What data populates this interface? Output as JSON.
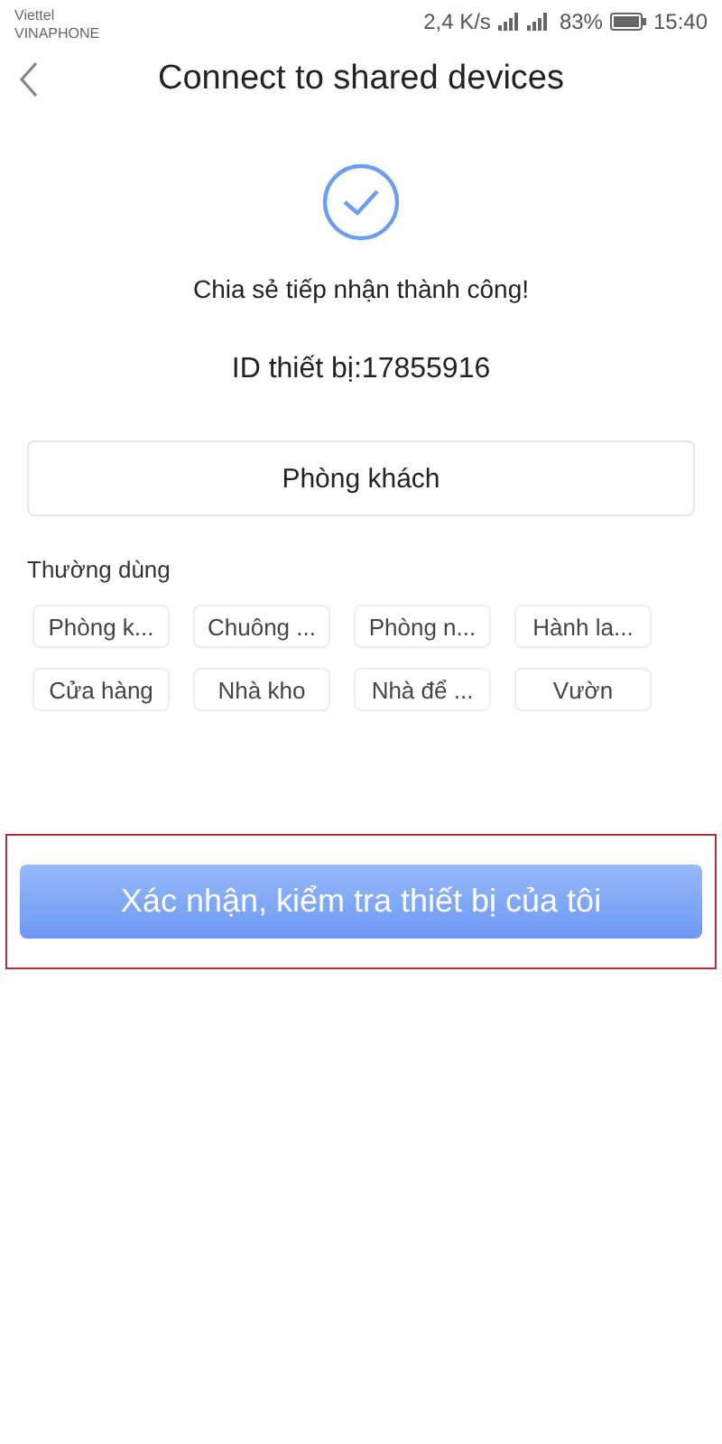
{
  "status_bar": {
    "carrier_1": "Viettel",
    "carrier_2": "VINAPHONE",
    "speed": "2,4 K/s",
    "battery": "83%",
    "time": "15:40"
  },
  "header": {
    "title": "Connect to shared devices"
  },
  "success_message": "Chia sẻ tiếp nhận thành công!",
  "device_id": "ID thiết bị:17855916",
  "room_field": {
    "value": "Phòng khách"
  },
  "frequent": {
    "label": "Thường dùng",
    "chips": [
      "Phòng k...",
      "Chuông ...",
      "Phòng n...",
      "Hành la...",
      "Cửa hàng",
      "Nhà kho",
      "Nhà để ...",
      "Vườn"
    ]
  },
  "confirm_button": {
    "label": "Xác nhận, kiểm tra thiết bị của tôi",
    "highlighted": true
  }
}
